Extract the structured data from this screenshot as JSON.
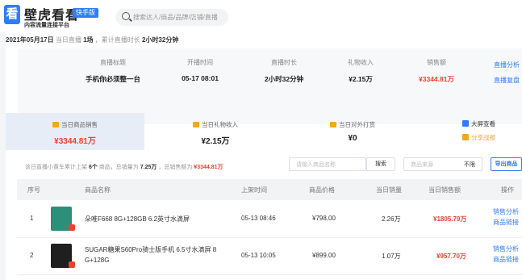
{
  "header": {
    "logo_glyph": "看",
    "brand": "壁虎看看",
    "badge": "快手版",
    "subtitle": "内容流量连接平台",
    "search_placeholder": "搜索达人/商品/品牌/店铺/直播"
  },
  "summary": {
    "date": "2021年05月17日",
    "live_prefix": "当日直播",
    "live_count": "1场",
    "duration_prefix": "，累计直播时长",
    "duration": "2小时32分钟"
  },
  "stats": {
    "columns": [
      {
        "label": "直播标题",
        "value": "手机你必须整一台"
      },
      {
        "label": "开播时间",
        "value": "05-17 08:01"
      },
      {
        "label": "直播时长",
        "value": "2小时32分钟"
      },
      {
        "label": "礼物收入",
        "value": "¥2.15万"
      },
      {
        "label": "销售额",
        "value": "¥3344.81万"
      }
    ],
    "link_analysis": "直播分析",
    "link_replay": "直播复盘"
  },
  "cards": [
    {
      "label": "当日商品销售",
      "value": "¥3344.81万"
    },
    {
      "label": "当日礼物收入",
      "value": "¥2.15万"
    },
    {
      "label": "当日对外打赏",
      "value": "¥0"
    }
  ],
  "right_links": {
    "big_screen": "大屏查看",
    "share": "分享战报"
  },
  "toolbar": {
    "p1": "该日直播小黄车累计上架",
    "count": "6个",
    "p2": "商品，总销量为",
    "sales": "7.25万",
    "p3": "，总销售额为",
    "amount": "¥3344.81万",
    "search_placeholder": "请输入商品名称",
    "search_btn": "搜索",
    "source_placeholder": "商品来源",
    "source_value": "不限",
    "export_btn": "导出商品"
  },
  "table": {
    "headers": {
      "index": "序号",
      "name": "商品名称",
      "time": "上架时间",
      "price": "商品价格",
      "volume": "当日销量",
      "amount": "当日销售额",
      "ops": "操作"
    },
    "rows": [
      {
        "index": "1",
        "name": "朵唯F668 8G+128GB 6.2英寸水滴屏",
        "name2": "",
        "time": "05-13 08:46",
        "price": "¥798.00",
        "volume": "2.26万",
        "amount": "¥1805.79万",
        "op1": "销售分析",
        "op2": "商品链接"
      },
      {
        "index": "2",
        "name": "SUGAR糖果S60Pro骑士版手机 6.5寸水滴屏 8",
        "name2": "G+128G",
        "time": "05-13 10:05",
        "price": "¥899.00",
        "volume": "1.07万",
        "amount": "¥957.70万",
        "op1": "销售分析",
        "op2": "商品链接"
      }
    ]
  },
  "colors": {
    "accent": "#2f7df6",
    "price_red": "#f0412f"
  }
}
